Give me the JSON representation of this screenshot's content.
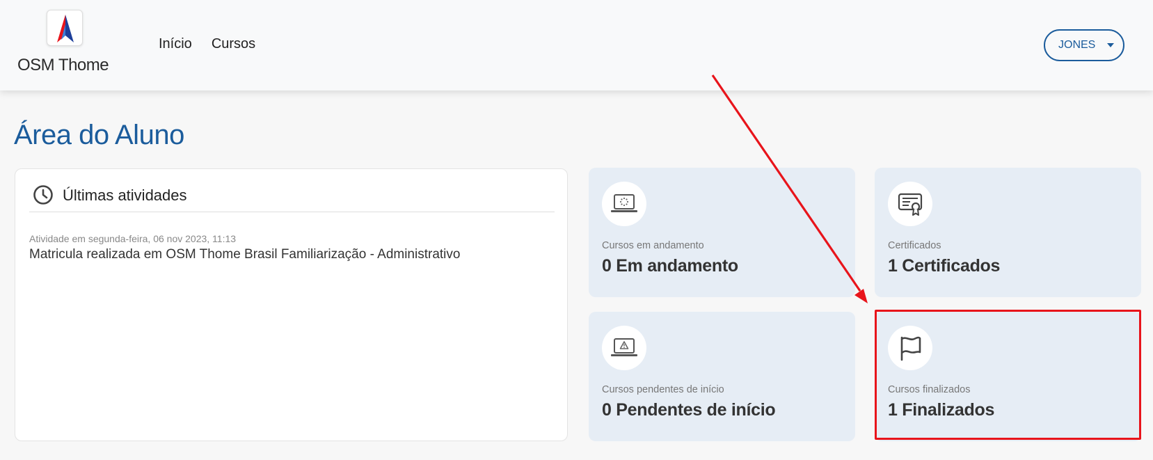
{
  "brand": {
    "name": "OSM Thome"
  },
  "nav": {
    "items": [
      "Início",
      "Cursos"
    ]
  },
  "user": {
    "name": "JONES"
  },
  "page": {
    "title": "Área do Aluno"
  },
  "activities": {
    "title": "Últimas atividades",
    "items": [
      {
        "meta": "Atividade em segunda-feira, 06 nov 2023, 11:13",
        "text": "Matricula realizada em OSM Thome Brasil Familiarização - Administrativo"
      }
    ]
  },
  "cards": [
    {
      "icon": "laptop-loading-icon",
      "label": "Cursos em andamento",
      "value": "0 Em andamento"
    },
    {
      "icon": "certificate-icon",
      "label": "Certificados",
      "value": "1 Certificados"
    },
    {
      "icon": "laptop-warning-icon",
      "label": "Cursos pendentes de início",
      "value": "0 Pendentes de início"
    },
    {
      "icon": "flag-icon",
      "label": "Cursos finalizados",
      "value": "1 Finalizados"
    }
  ],
  "colors": {
    "primary": "#1b5c9c",
    "card_bg": "#e6edf5",
    "annotation": "#e8141b"
  }
}
